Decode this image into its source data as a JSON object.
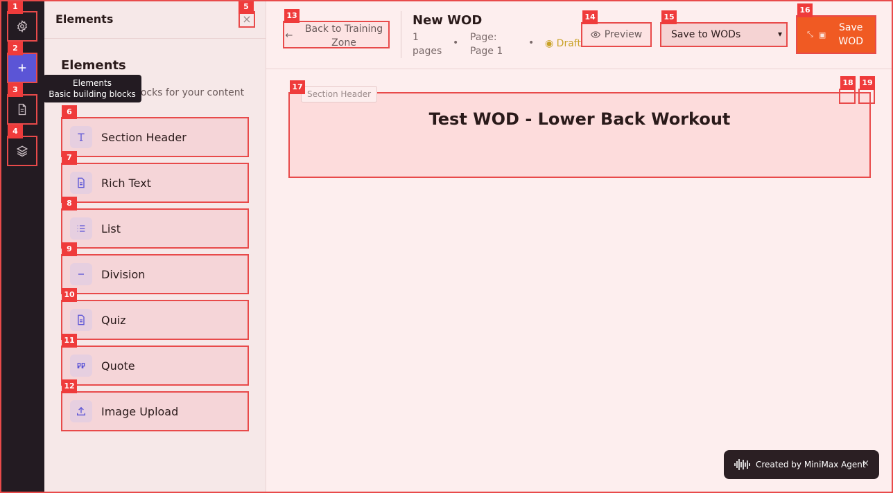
{
  "rail": {
    "tooltip": {
      "title": "Elements",
      "subtitle": "Basic building blocks"
    }
  },
  "panel": {
    "header_title": "Elements",
    "close_label": "×",
    "title": "Elements",
    "subtitle": "Basic building blocks for your content",
    "items": [
      {
        "label": "Section Header",
        "icon": "type-icon"
      },
      {
        "label": "Rich Text",
        "icon": "document-icon"
      },
      {
        "label": "List",
        "icon": "list-icon"
      },
      {
        "label": "Division",
        "icon": "minus-icon"
      },
      {
        "label": "Quiz",
        "icon": "document-icon"
      },
      {
        "label": "Quote",
        "icon": "quote-icon"
      },
      {
        "label": "Image Upload",
        "icon": "upload-icon"
      }
    ]
  },
  "header": {
    "back_label": "Back to Training Zone",
    "title": "New WOD",
    "pages_count": "1 pages",
    "page_label": "Page: Page 1",
    "status": "Draft",
    "preview_label": "Preview",
    "save_select_value": "Save to WODs",
    "save_button_label": "Save WOD"
  },
  "canvas": {
    "section_tag": "Section Header",
    "section_heading": "Test WOD - Lower Back Workout"
  },
  "toast": {
    "text": "Created by MiniMax Agent",
    "close_label": "×"
  },
  "badges": [
    "1",
    "2",
    "3",
    "4",
    "5",
    "6",
    "7",
    "8",
    "9",
    "10",
    "11",
    "12",
    "13",
    "14",
    "15",
    "16",
    "17",
    "18",
    "19"
  ],
  "colors": {
    "accent": "#5b55d6",
    "save_button": "#f05a23",
    "annotation": "#ef3b3b",
    "rail_bg": "#231b22",
    "draft": "#c9a227"
  }
}
